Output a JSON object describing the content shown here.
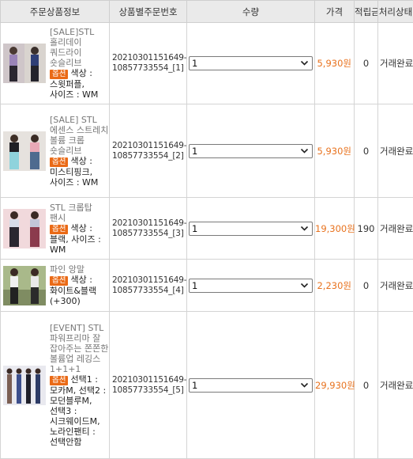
{
  "columns": {
    "info": "주문상품정보",
    "order_number": "상품별주문번호",
    "quantity": "수량",
    "price": "가격",
    "points": "적립금",
    "status": "처리상태"
  },
  "option_badge": "옵션",
  "rows": [
    {
      "name": "[SALE]STL 홀리데이 쿼드라이 숏슬리브",
      "option": "색상 : 스윗퍼플, 사이즈 : WM",
      "order_number_line1": "20210301151649-",
      "order_number_line2": "10857733554_[1]",
      "quantity": "1",
      "price": "5,930원",
      "points": "0",
      "status": "거래완료"
    },
    {
      "name": "[SALE] STL 에센스 스트레치 볼륨 크롭 숏슬리브",
      "option": "색상 : 미스티핑크, 사이즈 : WM",
      "order_number_line1": "20210301151649-",
      "order_number_line2": "10857733554_[2]",
      "quantity": "1",
      "price": "5,930원",
      "points": "0",
      "status": "거래완료"
    },
    {
      "name": "STL 크롭탑 팬시",
      "option": "색상 : 블랙, 사이즈 : WM",
      "order_number_line1": "20210301151649-",
      "order_number_line2": "10857733554_[3]",
      "quantity": "1",
      "price": "19,300원",
      "points": "190",
      "status": "거래완료"
    },
    {
      "name": "파인 앙말",
      "option": "색상 : 화이트&블랙 (+300)",
      "order_number_line1": "20210301151649-",
      "order_number_line2": "10857733554_[4]",
      "quantity": "1",
      "price": "2,230원",
      "points": "0",
      "status": "거래완료"
    },
    {
      "name": "[EVENT] STL 파워프리마 잘 잡아주는 쫀쫀한 볼륨업 레깅스 1+1+1",
      "option": "선택1 : 모카M, 선택2 : 모던블루M, 선택3 : 시크웨이드M, 노라인팬티 : 선택안함",
      "order_number_line1": "20210301151649-",
      "order_number_line2": "10857733554_[5]",
      "quantity": "1",
      "price": "29,930원",
      "points": "0",
      "status": "거래완료"
    }
  ],
  "icons": {
    "thumbnail": "product-photo",
    "select": "chevron-down-icon"
  },
  "colors": {
    "price": "#e8721e",
    "badge": "#ea6a16",
    "header_bg": "#eaeaea"
  }
}
